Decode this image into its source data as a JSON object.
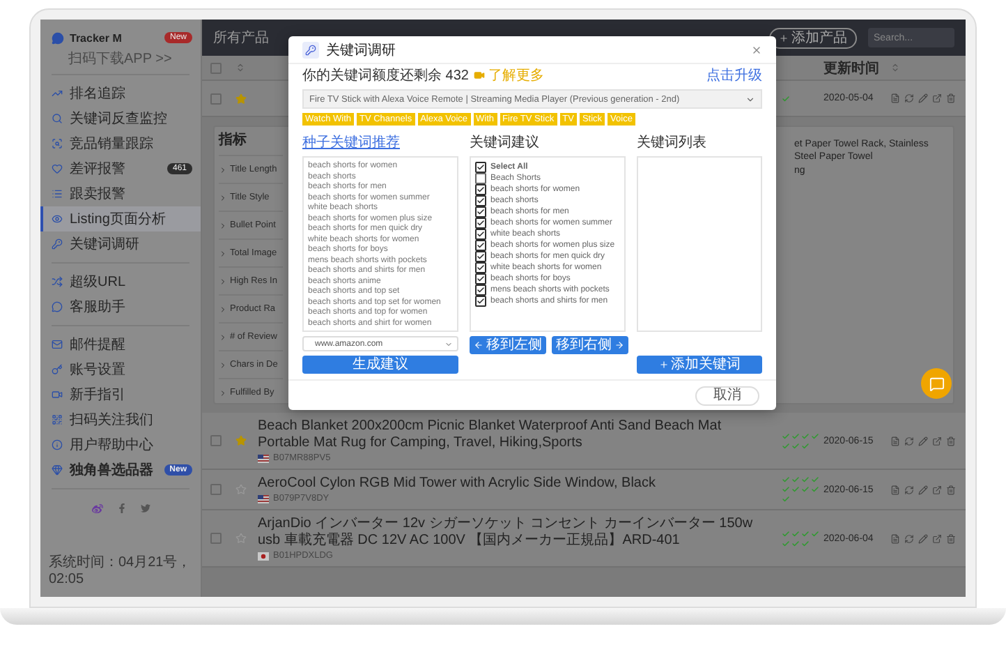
{
  "app": {
    "name": "Tracker M",
    "badge": {
      "text": "New",
      "color": "#a82a2a"
    },
    "download_link": "扫码下载APP >>"
  },
  "sidebar": {
    "groups": [
      [
        {
          "label": "排名追踪",
          "selected": false,
          "bold": false
        },
        {
          "label": "关键词反查监控",
          "selected": false,
          "bold": false
        },
        {
          "label": "竞品销量跟踪",
          "selected": false,
          "bold": false
        },
        {
          "label": "差评报警",
          "selected": false,
          "bold": false,
          "badge": {
            "text": "461",
            "color": "#2e2e2e"
          }
        },
        {
          "label": "跟卖报警",
          "selected": false,
          "bold": false
        },
        {
          "label": "Listing页面分析",
          "selected": true,
          "bold": false
        },
        {
          "label": "关键词调研",
          "selected": false,
          "bold": false
        }
      ],
      [
        {
          "label": "超级URL",
          "selected": false,
          "bold": false
        },
        {
          "label": "客服助手",
          "selected": false,
          "bold": false
        }
      ],
      [
        {
          "label": "邮件提醒",
          "selected": false,
          "bold": false
        },
        {
          "label": "账号设置",
          "selected": false,
          "bold": false
        },
        {
          "label": "新手指引",
          "selected": false,
          "bold": false
        },
        {
          "label": "扫码关注我们",
          "selected": false,
          "bold": false
        },
        {
          "label": "用户帮助中心",
          "selected": false,
          "bold": false
        },
        {
          "label": "独角兽选品器",
          "selected": false,
          "bold": true,
          "badge": {
            "text": "New",
            "color": "#2f4fa8"
          }
        }
      ]
    ],
    "footer": "系统时间：04月21号，02:05"
  },
  "topbar": {
    "tab": "所有产品",
    "add_button": "添加产品",
    "search": {
      "placeholder": "Search..."
    }
  },
  "table": {
    "select_all_checked": false,
    "columns": [
      {
        "label": "更新时间"
      }
    ],
    "rows": [
      {
        "checked": false,
        "starred": true,
        "checks": [
          {
            "passed": true
          }
        ],
        "date": "2020-05-04"
      },
      {
        "checked": false,
        "starred": true,
        "title": "Beach Blanket 200x200cm Picnic Blanket Waterproof Anti Sand Beach Mat Portable Mat Rug for Camping, Travel, Hiking,Sports",
        "flag": {
          "kind": "us"
        },
        "asin": "B07MR88PV5",
        "checks": [
          {
            "passed": true
          },
          {
            "passed": true
          },
          {
            "passed": true
          },
          {
            "passed": true
          },
          {
            "passed": true
          },
          {
            "passed": true
          },
          {
            "passed": true
          }
        ],
        "date": "2020-06-15"
      },
      {
        "checked": false,
        "starred": false,
        "title": "AeroCool Cylon RGB Mid Tower with Acrylic Side Window, Black",
        "flag": {
          "kind": "us"
        },
        "asin": "B079P7V8DY",
        "checks": [
          {
            "passed": true
          },
          {
            "passed": true
          },
          {
            "passed": true
          },
          {
            "passed": true
          },
          {
            "passed": true
          },
          {
            "passed": true
          },
          {
            "passed": true
          },
          {
            "passed": true
          },
          {
            "passed": true
          }
        ],
        "date": "2020-06-15"
      },
      {
        "checked": false,
        "starred": false,
        "title": "ArjanDio インバーター 12v シガーソケット コンセント カーインバーター 150w usb 車載充電器 DC 12V AC 100V 【国内メーカー正規品】ARD-401",
        "flag": {
          "kind": "jp"
        },
        "asin": "B01HPDXLDG",
        "checks": [
          {
            "passed": true
          },
          {
            "passed": true
          },
          {
            "passed": true
          },
          {
            "passed": true
          },
          {
            "passed": true
          },
          {
            "passed": true
          },
          {
            "passed": true
          }
        ],
        "date": "2020-06-04"
      }
    ]
  },
  "detail": {
    "heading": "指标",
    "metrics": [
      "Title Length",
      "Title Style",
      "Bullet Point",
      "Total Image",
      "High Res In",
      "Product Ra",
      "# of Review",
      "Chars in De",
      "Fulfilled By"
    ],
    "title_fragment": [
      "et Paper Towel Rack, Stainless Steel Paper Towel",
      "ng"
    ]
  },
  "modal": {
    "title": "关键词调研",
    "quota": "你的关键词额度还剩余 432",
    "learn_more": "了解更多",
    "upgrade": "点击升级",
    "product": "Fire TV Stick with Alexa Voice Remote | Streaming Media Player (Previous generation - 2nd)",
    "tags": [
      "Watch With",
      "TV Channels",
      "Alexa Voice",
      "With",
      "Fire TV Stick",
      "TV",
      "Stick",
      "Voice"
    ],
    "seed": {
      "heading": "种子关键词推荐",
      "keywords": [
        "beach shorts for women",
        "beach shorts",
        "beach shorts for men",
        "beach shorts for women summer",
        "white beach shorts",
        "beach shorts for women plus size",
        "beach shorts for men quick dry",
        "white beach shorts for women",
        "beach shorts for boys",
        "mens beach shorts with pockets",
        "beach shorts and shirts for men",
        "beach shorts anime",
        "beach shorts and top set",
        "beach shorts and top set for women",
        "beach shorts and top for women",
        "beach shorts and shirt for women"
      ],
      "marketplace": "www.amazon.com",
      "button": "生成建议"
    },
    "suggestions": {
      "heading": "关键词建议",
      "items": [
        {
          "kind": "select_all",
          "label": "Select All",
          "checked": true
        },
        {
          "kind": "keyword",
          "label": "Beach Shorts",
          "checked": false
        },
        {
          "kind": "keyword",
          "label": "beach shorts for women",
          "checked": true
        },
        {
          "kind": "keyword",
          "label": "beach shorts",
          "checked": true
        },
        {
          "kind": "keyword",
          "label": "beach shorts for men",
          "checked": true
        },
        {
          "kind": "keyword",
          "label": "beach shorts for women summer",
          "checked": true
        },
        {
          "kind": "keyword",
          "label": "white beach shorts",
          "checked": true
        },
        {
          "kind": "keyword",
          "label": "beach shorts for women plus size",
          "checked": true
        },
        {
          "kind": "keyword",
          "label": "beach shorts for men quick dry",
          "checked": true
        },
        {
          "kind": "keyword",
          "label": "white beach shorts for women",
          "checked": true
        },
        {
          "kind": "keyword",
          "label": "beach shorts for boys",
          "checked": true
        },
        {
          "kind": "keyword",
          "label": "mens beach shorts with pockets",
          "checked": true
        },
        {
          "kind": "keyword",
          "label": "beach shorts and shirts for men",
          "checked": true
        }
      ],
      "move_left": "移到左侧",
      "move_right": "移到右侧"
    },
    "list": {
      "heading": "关键词列表",
      "button": "添加关键词"
    },
    "cancel": "取消"
  }
}
